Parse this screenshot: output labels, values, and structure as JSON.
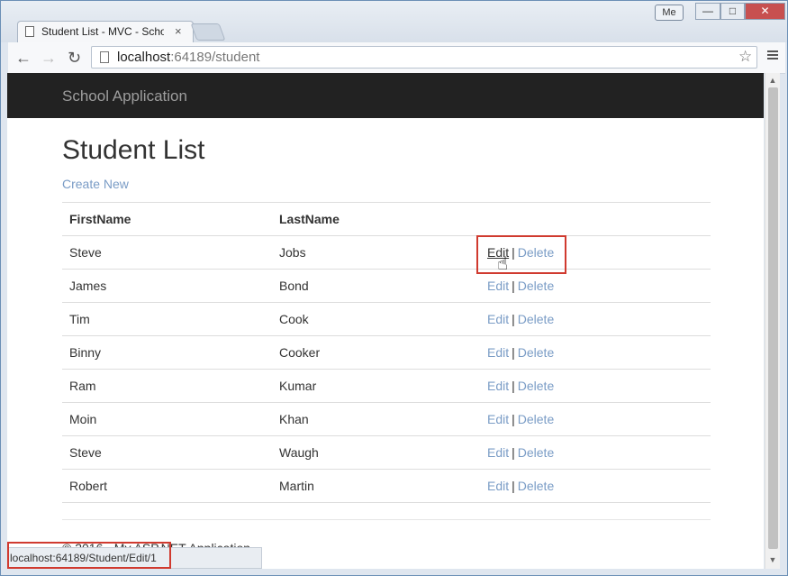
{
  "browser": {
    "profile": "Me",
    "tab_title": "Student List - MVC - Scho",
    "tab_close": "×",
    "url_host": "localhost",
    "url_rest": ":64189/student",
    "status_url": "localhost:64189/Student/Edit/1"
  },
  "window": {
    "minimize": "—",
    "maximize": "□",
    "close": "✕"
  },
  "app": {
    "brand": "School Application"
  },
  "page": {
    "title": "Student List",
    "create_link": "Create New",
    "footer": "© 2016 - My ASP.NET Application"
  },
  "table": {
    "headers": [
      "FirstName",
      "LastName"
    ],
    "rows": [
      {
        "first": "Steve",
        "last": "Jobs",
        "edit": "Edit",
        "delete": "Delete"
      },
      {
        "first": "James",
        "last": "Bond",
        "edit": "Edit",
        "delete": "Delete"
      },
      {
        "first": "Tim",
        "last": "Cook",
        "edit": "Edit",
        "delete": "Delete"
      },
      {
        "first": "Binny",
        "last": "Cooker",
        "edit": "Edit",
        "delete": "Delete"
      },
      {
        "first": "Ram",
        "last": "Kumar",
        "edit": "Edit",
        "delete": "Delete"
      },
      {
        "first": "Moin",
        "last": "Khan",
        "edit": "Edit",
        "delete": "Delete"
      },
      {
        "first": "Steve",
        "last": "Waugh",
        "edit": "Edit",
        "delete": "Delete"
      },
      {
        "first": "Robert",
        "last": "Martin",
        "edit": "Edit",
        "delete": "Delete"
      }
    ],
    "separator": "|"
  },
  "colors": {
    "navbar": "#222222",
    "link": "#7a9cc6",
    "highlight": "#d03a2f"
  }
}
